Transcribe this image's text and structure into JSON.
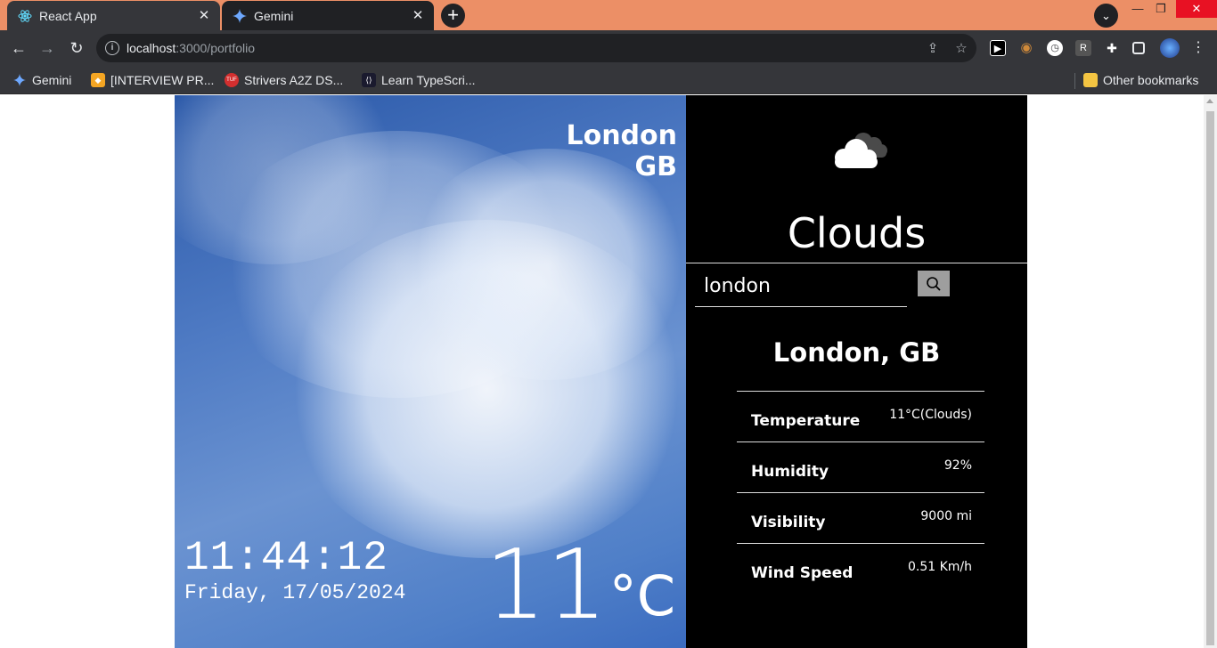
{
  "browser": {
    "tabs": [
      {
        "title": "React App",
        "active": true
      },
      {
        "title": "Gemini",
        "active": false
      }
    ],
    "url_host": "localhost",
    "url_path": ":3000/portfolio",
    "bookmarks": [
      {
        "label": "Gemini"
      },
      {
        "label": "[INTERVIEW PR..."
      },
      {
        "label": "Strivers A2Z DS..."
      },
      {
        "label": "Learn TypeScri..."
      }
    ],
    "other_bookmarks": "Other bookmarks",
    "colors": {
      "frame": "#ec8f66",
      "toolbar": "#35363a"
    }
  },
  "weather": {
    "city": "London",
    "country": "GB",
    "time": "11:44:12",
    "date": "Friday, 17/05/2024",
    "temperature_value": "11",
    "temperature_unit": "°C",
    "condition": "Clouds",
    "search_value": "london",
    "location_title": "London, GB",
    "stats": [
      {
        "label": "Temperature",
        "value": "11°C(Clouds)"
      },
      {
        "label": "Humidity",
        "value": "92%"
      },
      {
        "label": "Visibility",
        "value": "9000 mi"
      },
      {
        "label": "Wind Speed",
        "value": "0.51 Km/h"
      }
    ]
  }
}
